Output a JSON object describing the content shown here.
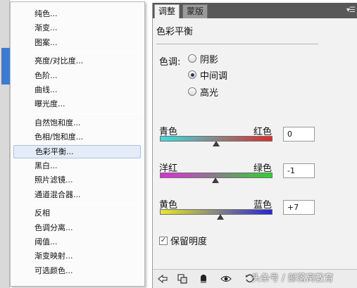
{
  "menu": {
    "groups": [
      [
        "纯色...",
        "渐变...",
        "图案..."
      ],
      [
        "亮度/对比度...",
        "色阶...",
        "曲线...",
        "曝光度..."
      ],
      [
        "自然饱和度...",
        "色相/饱和度...",
        "色彩平衡...",
        "黑白...",
        "照片滤镜...",
        "通道混合器..."
      ],
      [
        "反相",
        "色调分离...",
        "阈值...",
        "渐变映射...",
        "可选颜色..."
      ]
    ],
    "highlighted": "色彩平衡..."
  },
  "panel": {
    "tabs": [
      "调整",
      "蒙版"
    ],
    "active_tab": "调整",
    "title": "色彩平衡",
    "tone_label": "色调:",
    "tones": [
      "阴影",
      "中间调",
      "高光"
    ],
    "selected_tone": "中间调",
    "sliders": [
      {
        "left": "青色",
        "right": "红色",
        "value": "0",
        "position": 0.5,
        "colors": [
          "#36e0e0",
          "#e02a2a"
        ]
      },
      {
        "left": "洋红",
        "right": "绿色",
        "value": "-1",
        "position": 0.495,
        "colors": [
          "#e02ae0",
          "#2ad62a"
        ]
      },
      {
        "left": "黄色",
        "right": "蓝色",
        "value": "+7",
        "position": 0.535,
        "colors": [
          "#e8e826",
          "#2626d8"
        ]
      }
    ],
    "preserve_luminosity_label": "保留明度",
    "preserve_luminosity": true
  },
  "bottom_icons": [
    "back-arrow-icon",
    "clip-layer-icon",
    "mask-visibility-icon",
    "eye-icon",
    "reset-icon",
    "refresh-icon",
    "trash-icon"
  ],
  "watermark": "头条号 / 部落窝教育",
  "colors": {
    "tabbar": "#585858",
    "panel_bg": "#f2f2f2",
    "menu_highlight": "#e4ecf7"
  }
}
